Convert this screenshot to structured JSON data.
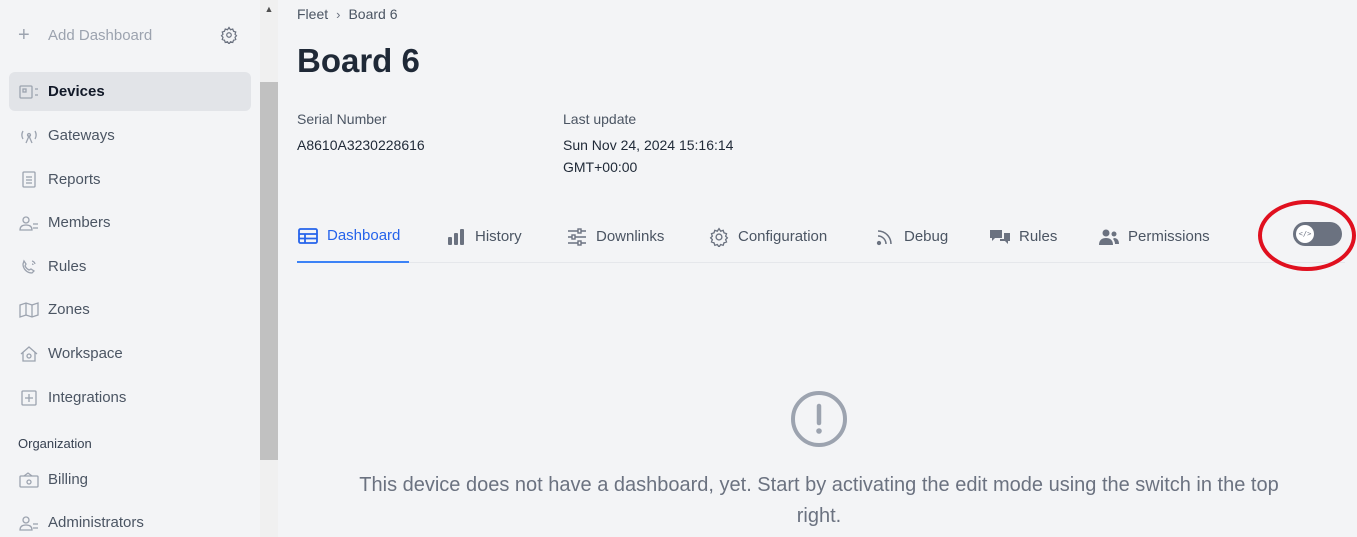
{
  "sidebar": {
    "add_dashboard": "Add Dashboard",
    "items": [
      {
        "label": "Devices",
        "icon": "devices-icon",
        "active": true
      },
      {
        "label": "Gateways",
        "icon": "gateway-icon"
      },
      {
        "label": "Reports",
        "icon": "report-icon"
      },
      {
        "label": "Members",
        "icon": "members-icon"
      },
      {
        "label": "Rules",
        "icon": "rules-icon"
      },
      {
        "label": "Zones",
        "icon": "map-icon"
      },
      {
        "label": "Workspace",
        "icon": "workspace-icon"
      },
      {
        "label": "Integrations",
        "icon": "integrations-icon"
      }
    ],
    "section_label": "Organization",
    "org_items": [
      {
        "label": "Billing",
        "icon": "billing-icon"
      },
      {
        "label": "Administrators",
        "icon": "administrators-icon"
      }
    ]
  },
  "breadcrumb": {
    "parent": "Fleet",
    "current": "Board 6"
  },
  "device": {
    "title": "Board 6",
    "serial_label": "Serial Number",
    "serial_value": "A8610A3230228616",
    "update_label": "Last update",
    "update_value_line1": "Sun Nov 24, 2024 15:16:14",
    "update_value_line2": "GMT+00:00"
  },
  "tabs": [
    {
      "label": "Dashboard",
      "icon": "table-icon",
      "active": true
    },
    {
      "label": "History",
      "icon": "bar-chart-icon"
    },
    {
      "label": "Downlinks",
      "icon": "sliders-icon"
    },
    {
      "label": "Configuration",
      "icon": "gear-icon"
    },
    {
      "label": "Debug",
      "icon": "signal-icon"
    },
    {
      "label": "Rules",
      "icon": "chat-icon"
    },
    {
      "label": "Permissions",
      "icon": "users-icon"
    }
  ],
  "edit_toggle": {
    "icon": "code-icon",
    "on": false,
    "highlight_color": "#e0101f"
  },
  "empty_state": {
    "icon": "alert-circle-icon",
    "message": "This device does not have a dashboard, yet. Start by activating the edit mode using the switch in the top right."
  },
  "colors": {
    "accent": "#2563eb",
    "sidebar_active": "#e2e4e8"
  }
}
